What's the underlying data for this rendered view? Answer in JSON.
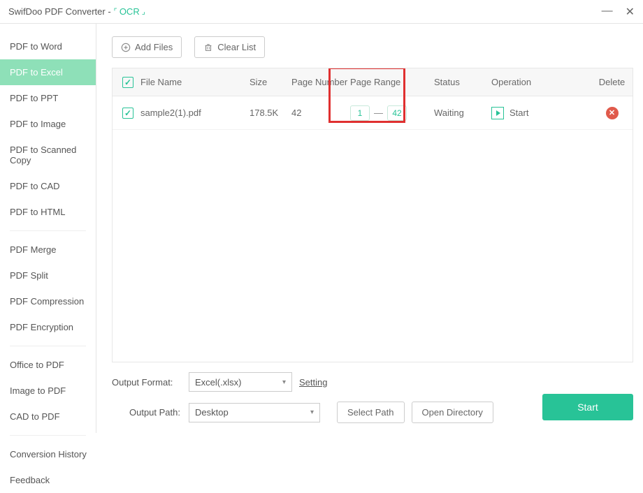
{
  "titlebar": {
    "appName": "SwifDoo PDF Converter -",
    "ocr": "OCR"
  },
  "sidebar": [
    {
      "label": "PDF to Word",
      "active": false
    },
    {
      "label": "PDF to Excel",
      "active": true
    },
    {
      "label": "PDF to PPT",
      "active": false
    },
    {
      "label": "PDF to Image",
      "active": false
    },
    {
      "label": "PDF to Scanned Copy",
      "active": false
    },
    {
      "label": "PDF to CAD",
      "active": false
    },
    {
      "label": "PDF to HTML",
      "active": false
    },
    {
      "sep": true
    },
    {
      "label": "PDF Merge",
      "active": false
    },
    {
      "label": "PDF Split",
      "active": false
    },
    {
      "label": "PDF Compression",
      "active": false
    },
    {
      "label": "PDF Encryption",
      "active": false
    },
    {
      "sep": true
    },
    {
      "label": "Office to PDF",
      "active": false
    },
    {
      "label": "Image to PDF",
      "active": false
    },
    {
      "label": "CAD to PDF",
      "active": false
    },
    {
      "sep": true
    },
    {
      "label": "Conversion History",
      "active": false
    },
    {
      "label": "Feedback",
      "active": false
    }
  ],
  "toolbar": {
    "addFiles": "Add Files",
    "clearList": "Clear List"
  },
  "table": {
    "headers": {
      "fileName": "File Name",
      "size": "Size",
      "pageNumber": "Page Number",
      "pageRange": "Page Range",
      "status": "Status",
      "operation": "Operation",
      "delete": "Delete"
    },
    "rows": [
      {
        "checked": true,
        "fileName": "sample2(1).pdf",
        "size": "178.5K",
        "pageNumber": "42",
        "rangeFrom": "1",
        "rangeTo": "42",
        "status": "Waiting",
        "operation": "Start"
      }
    ]
  },
  "bottom": {
    "outputFormatLabel": "Output Format:",
    "outputFormatValue": "Excel(.xlsx)",
    "settingLink": "Setting",
    "outputPathLabel": "Output Path:",
    "outputPathValue": "Desktop",
    "selectPath": "Select Path",
    "openDirectory": "Open Directory",
    "start": "Start"
  }
}
